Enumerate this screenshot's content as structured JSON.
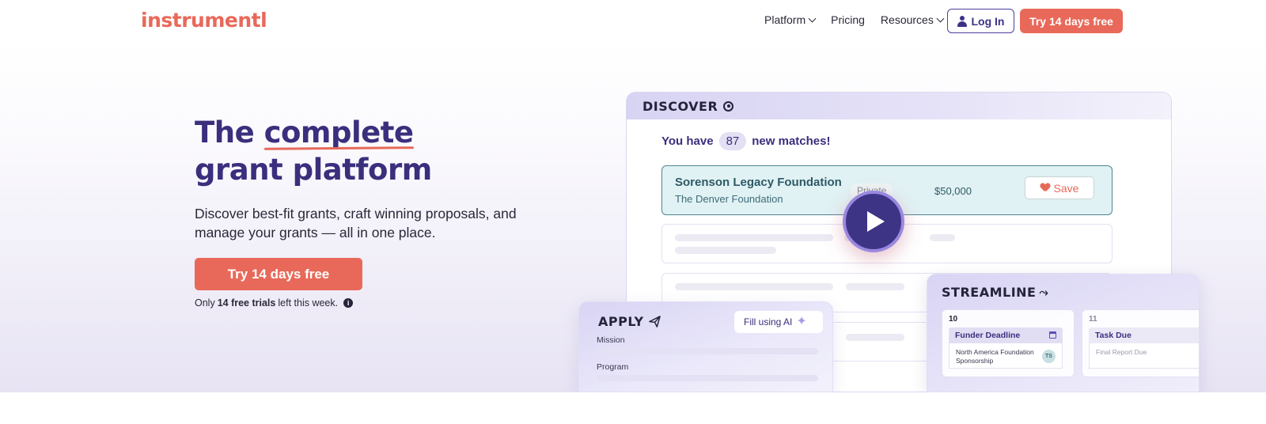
{
  "nav": {
    "logo": "instrumentl",
    "links": [
      {
        "label": "Platform",
        "has_dropdown": true
      },
      {
        "label": "Pricing",
        "has_dropdown": false
      },
      {
        "label": "Resources",
        "has_dropdown": true
      }
    ],
    "login_label": "Log In",
    "trial_label": "Try 14 days free"
  },
  "hero": {
    "title_line1_prefix": "The ",
    "title_line1_emphasis": "complete",
    "title_line2": "grant platform",
    "subtitle": "Discover best-fit grants, craft winning proposals, and manage your grants — all in one place.",
    "cta_label": "Try 14 days free",
    "note_prefix": "Only",
    "note_bold": "14 free trials",
    "note_suffix": "left this week.",
    "info_icon": "i"
  },
  "discover": {
    "title": "DISCOVER",
    "matches_prefix": "You have",
    "matches_count": "87",
    "matches_suffix": "new matches!",
    "grant": {
      "name": "Sorenson Legacy Foundation",
      "org": "The Denver Foundation",
      "tag": "Private",
      "amount": "$50,000",
      "save_label": "Save"
    }
  },
  "apply": {
    "title": "APPLY",
    "fill_ai_label": "Fill using AI",
    "fields": [
      "Mission",
      "Program"
    ]
  },
  "streamline": {
    "title": "STREAMLINE",
    "days": [
      {
        "num": "10",
        "event": "Funder Deadline",
        "detail": "North America Foundation Sponsorship",
        "avatar": "TS"
      },
      {
        "num": "11",
        "event": "Task Due",
        "detail": "Final Report Due"
      }
    ]
  },
  "colors": {
    "brand": "#e8695a",
    "primary": "#3a2f7d",
    "grant_highlight": "#e1f2f4"
  }
}
